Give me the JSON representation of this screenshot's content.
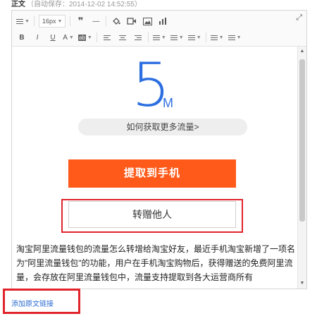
{
  "header": {
    "title": "正文",
    "autosave": "（自动保存：2014-12-02 14:52:55）"
  },
  "toolbar": {
    "font_size": "16px",
    "quote_symbol": "❞",
    "hr_symbol": "—",
    "icons": [
      "quote-icon",
      "horizontal-rule-icon",
      "paint-bucket-icon",
      "video-icon",
      "image-icon",
      "chart-icon",
      "expand-icon"
    ],
    "bold": "B",
    "italic": "I",
    "underline": "U",
    "font_color": "A",
    "highlight": "ab"
  },
  "content": {
    "big_number": "5",
    "unit": "M",
    "more_flow_link": "如何获取更多流量>",
    "extract_button": "提取到手机",
    "gift_button": "转赠他人",
    "paragraph": "淘宝阿里流量钱包的流量怎么转增给淘宝好友，最近手机淘宝新增了一项名为\"阿里流量钱包\"的功能，用户在手机淘宝购物后，获得赠送的免费阿里流量，会存放在阿里流量钱包中，流量支持提取到各大运营商所有"
  },
  "footer": {
    "add_link": "添加原文链接"
  },
  "colors": {
    "accent_blue": "#2d6fe0",
    "orange": "#ff5a1a",
    "highlight_red": "#e0242b"
  }
}
